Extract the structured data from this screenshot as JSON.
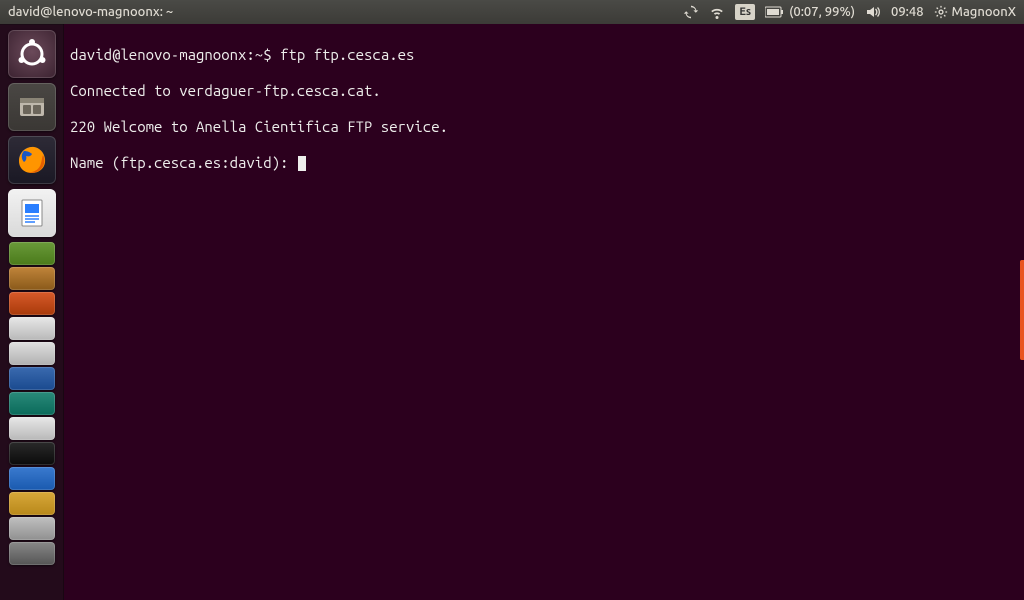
{
  "menubar": {
    "window_title": "david@lenovo-magnoonx: ~",
    "keyboard_layout": "Es",
    "battery_text": "(0:07, 99%)",
    "clock": "09:48",
    "session_name": "MagnoonX"
  },
  "launcher": {
    "items": [
      {
        "name": "dash",
        "label": "Dash"
      },
      {
        "name": "files",
        "label": "Files"
      },
      {
        "name": "firefox",
        "label": "Firefox"
      },
      {
        "name": "writer",
        "label": "LibreOffice Writer"
      }
    ]
  },
  "terminal": {
    "prompt": "david@lenovo-magnoonx:~$ ",
    "command": "ftp ftp.cesca.es",
    "lines": [
      "Connected to verdaguer-ftp.cesca.cat.",
      "220 Welcome to Anella Cientifica FTP service.",
      "Name (ftp.cesca.es:david): "
    ]
  }
}
